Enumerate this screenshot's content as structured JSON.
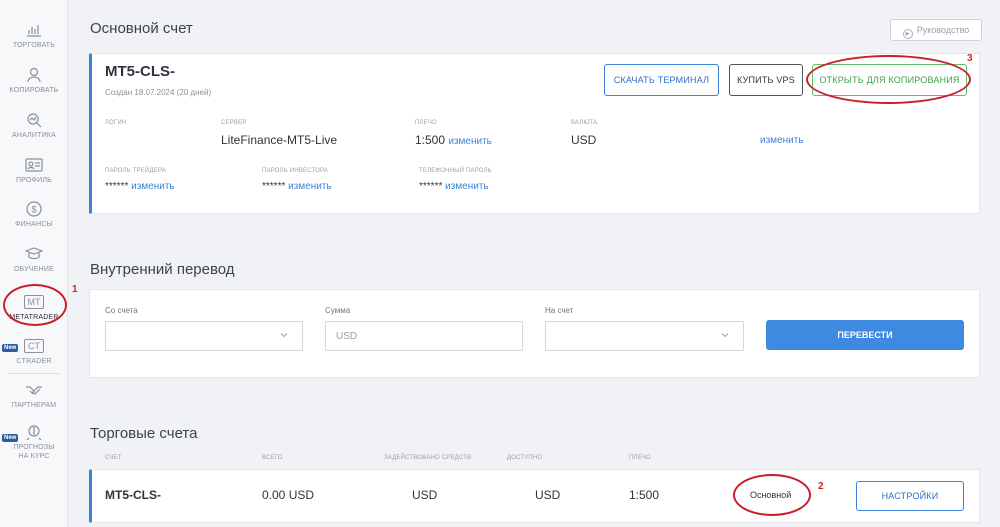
{
  "sidebar": {
    "items": [
      {
        "label": "ТОРГОВАТЬ",
        "icon": "trade-chart-icon"
      },
      {
        "label": "КОПИРОВАТЬ",
        "icon": "copy-trader-icon"
      },
      {
        "label": "АНАЛИТИКА",
        "icon": "analytics-search-icon"
      },
      {
        "label": "ПРОФИЛЬ",
        "icon": "profile-card-icon"
      },
      {
        "label": "ФИНАНСЫ",
        "icon": "dollar-coin-icon"
      },
      {
        "label": "ОБУЧЕНИЕ",
        "icon": "graduation-cap-icon"
      },
      {
        "label": "METATRADER",
        "icon_text": "MT"
      },
      {
        "label": "CTRADER",
        "icon_text": "CT",
        "badge": "New"
      },
      {
        "label": "ПАРТНЕРАМ",
        "icon": "handshake-icon"
      },
      {
        "label": "ПРОГНОЗЫ НА КУРС",
        "icon": "forecast-coin-icon",
        "badge": "New"
      }
    ]
  },
  "annotations": {
    "n1": "1",
    "n2": "2",
    "n3": "3"
  },
  "main_account": {
    "section_title": "Основной счет",
    "guide_label": "Руководство",
    "name": "MT5-CLS-",
    "created": "Создан 18.07.2024 (20 дней)",
    "buttons": {
      "download": "СКАЧАТЬ ТЕРМИНАЛ",
      "vps": "КУПИТЬ VPS",
      "copy": "ОТКРЫТЬ ДЛЯ КОПИРОВАНИЯ"
    },
    "login_cap": "ЛОГИН",
    "server_cap": "СЕРВЕР",
    "server": "LiteFinance-MT5-Live",
    "leverage_cap": "ПЛЕЧО",
    "leverage": "1:500",
    "currency_cap": "ВАЛЮТА",
    "currency": "USD",
    "change": "изменить",
    "change_partial": "изменить",
    "trader_pass_cap": "ПАРОЛЬ ТРЕЙДЕРА",
    "investor_pass_cap": "ПАРОЛЬ ИНВЕСТОРА",
    "phone_pass_cap": "ТЕЛЕФОННЫЙ ПАРОЛЬ",
    "masked": "******"
  },
  "transfer": {
    "section_title": "Внутренний перевод",
    "from_label": "Со счета",
    "amount_label": "Сумма",
    "amount_placeholder": "USD",
    "to_label": "На счет",
    "submit": "ПЕРЕВЕСТИ"
  },
  "trading_accounts": {
    "section_title": "Торговые счета",
    "columns": [
      "СЧЕТ",
      "ВСЕГО",
      "ЗАДЕЙСТВОВАНО СРЕДСТВ",
      "ДОСТУПНО",
      "ПЛЕЧО"
    ],
    "rows": [
      {
        "account": "MT5-CLS-",
        "total": "0.00 USD",
        "used": "USD",
        "available": "USD",
        "leverage": "1:500",
        "status": "Основной",
        "action": "НАСТРОЙКИ"
      }
    ]
  }
}
